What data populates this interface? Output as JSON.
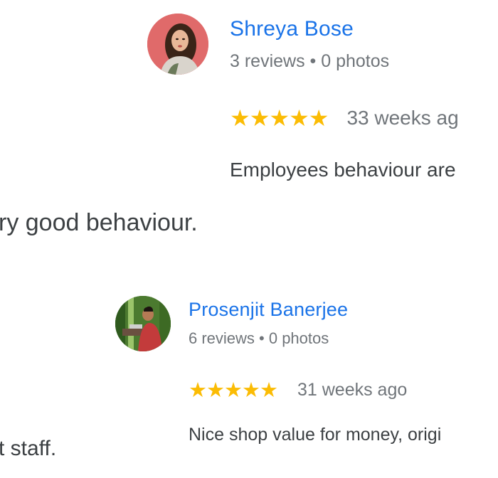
{
  "reviews": [
    {
      "author": "Shreya Bose",
      "meta": "3 reviews • 0 photos",
      "stars": "★★★★★",
      "rating": 5,
      "age": "33 weeks ag",
      "text": "Employees behaviour are",
      "avatar_icon": "profile-photo-avatar",
      "avatar_bg": "#e06a6a"
    },
    {
      "author": "Prosenjit Banerjee",
      "meta": "6 reviews • 0 photos",
      "stars": "★★★★★",
      "rating": 5,
      "age": "31 weeks ago",
      "text": "Nice shop value for money, origi",
      "avatar_icon": "profile-photo-avatar",
      "avatar_bg": "#4b7a2f"
    }
  ],
  "background_text": {
    "line1": "ry good behaviour.",
    "line2": "t staff."
  },
  "colors": {
    "name": "#1a73e8",
    "star": "#fbbc04",
    "meta": "#70757a",
    "text": "#3c4043"
  }
}
